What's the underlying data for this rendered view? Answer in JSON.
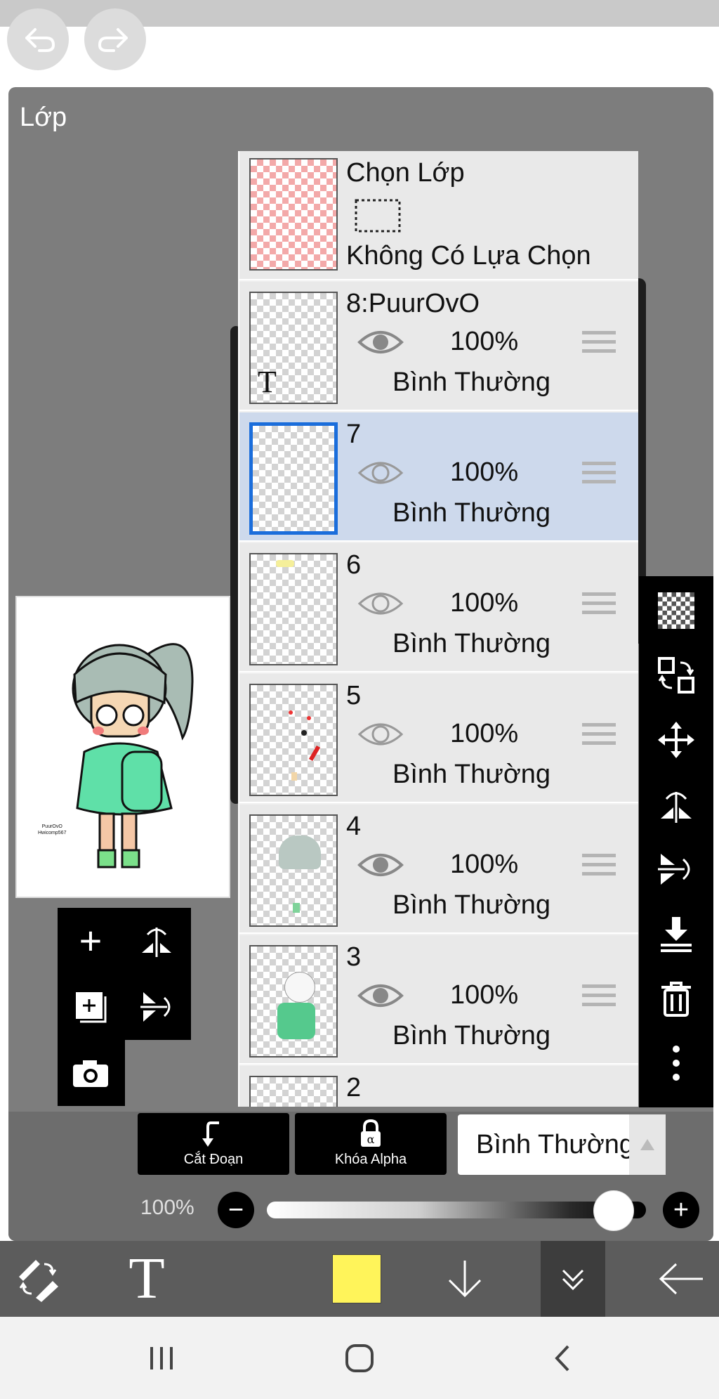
{
  "header": {
    "undo_icon": "undo-icon",
    "redo_icon": "redo-icon"
  },
  "panel": {
    "title": "Lớp"
  },
  "selection_row": {
    "title": "Chọn Lớp",
    "status": "Không Có Lựa Chọn"
  },
  "layers": [
    {
      "name": "8:PuurOvO",
      "opacity": "100%",
      "blend": "Bình Thường",
      "selected": false,
      "visible": true
    },
    {
      "name": "7",
      "opacity": "100%",
      "blend": "Bình Thường",
      "selected": true,
      "visible": true
    },
    {
      "name": "6",
      "opacity": "100%",
      "blend": "Bình Thường",
      "selected": false,
      "visible": true
    },
    {
      "name": "5",
      "opacity": "100%",
      "blend": "Bình Thường",
      "selected": false,
      "visible": true
    },
    {
      "name": "4",
      "opacity": "100%",
      "blend": "Bình Thường",
      "selected": false,
      "visible": true
    },
    {
      "name": "3",
      "opacity": "100%",
      "blend": "Bình Thường",
      "selected": false,
      "visible": true
    },
    {
      "name": "2"
    }
  ],
  "preview": {
    "signature_line1": "PuurOvO",
    "signature_line2": "Hwicomp567"
  },
  "bottom": {
    "clip_label": "Cắt Đoạn",
    "alpha_lock_label": "Khóa Alpha",
    "blend_mode": "Bình Thường",
    "opacity_label": "100%",
    "opacity_value": 1.0
  },
  "toolbar": {
    "color_swatch": "#fff45a"
  },
  "colors": {
    "selected_row": "#cdd9ec",
    "selected_border": "#1a6ddb",
    "panel_bg": "#7d7d7d"
  }
}
